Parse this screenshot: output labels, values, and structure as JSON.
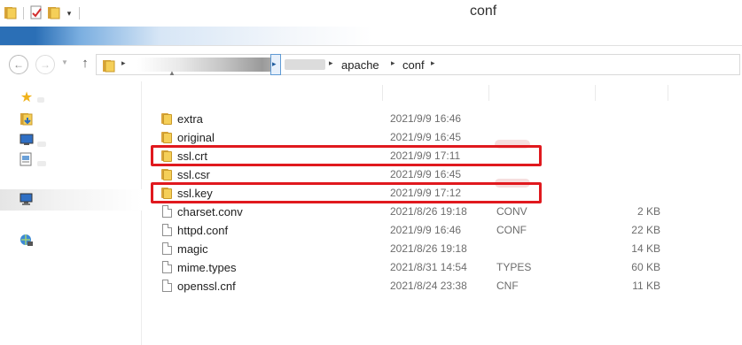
{
  "window": {
    "title": "conf"
  },
  "address_bar": {
    "separator_glyph": "▸",
    "crumbs": [
      "apache",
      "conf"
    ]
  },
  "colors": {
    "highlight_box": "#e0191e",
    "folder": "#f5cf58",
    "ribbon_accent": "#2b6fb6"
  },
  "files": [
    {
      "name": "extra",
      "date": "2021/9/9 16:46",
      "type": "",
      "size": "",
      "icon": "folder-icon"
    },
    {
      "name": "original",
      "date": "2021/9/9 16:45",
      "type": "",
      "size": "",
      "icon": "folder-icon"
    },
    {
      "name": "ssl.crt",
      "date": "2021/9/9 17:11",
      "type": "",
      "size": "",
      "icon": "folder-icon",
      "highlighted": true
    },
    {
      "name": "ssl.csr",
      "date": "2021/9/9 16:45",
      "type": "",
      "size": "",
      "icon": "folder-icon"
    },
    {
      "name": "ssl.key",
      "date": "2021/9/9 17:12",
      "type": "",
      "size": "",
      "icon": "folder-icon",
      "highlighted": true
    },
    {
      "name": "charset.conv",
      "date": "2021/8/26 19:18",
      "type": "CONV",
      "size": "2 KB",
      "icon": "document-icon"
    },
    {
      "name": "httpd.conf",
      "date": "2021/9/9 16:46",
      "type": "CONF",
      "size": "22 KB",
      "icon": "document-icon"
    },
    {
      "name": "magic",
      "date": "2021/8/26 19:18",
      "type": "",
      "size": "14 KB",
      "icon": "document-icon"
    },
    {
      "name": "mime.types",
      "date": "2021/8/31 14:54",
      "type": "TYPES",
      "size": "60 KB",
      "icon": "document-icon"
    },
    {
      "name": "openssl.cnf",
      "date": "2021/8/24 23:38",
      "type": "CNF",
      "size": "11 KB",
      "icon": "document-icon"
    }
  ]
}
